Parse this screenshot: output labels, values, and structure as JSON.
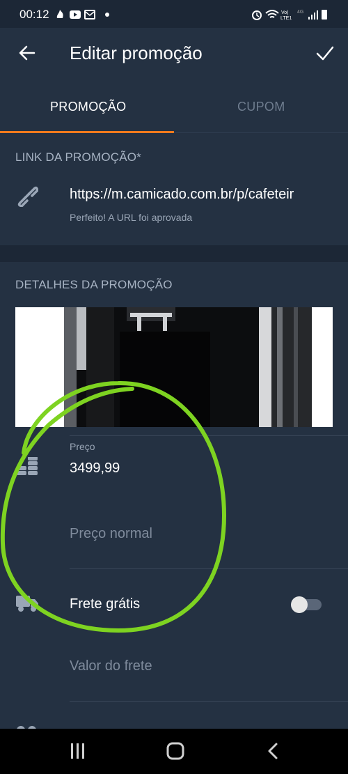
{
  "status_bar": {
    "time": "00:12",
    "icons": [
      "fire-icon",
      "youtube-icon",
      "gmail-icon",
      "dot-icon",
      "alarm-icon",
      "wifi-icon",
      "volte-icon",
      "signal-icon",
      "battery-icon"
    ],
    "network_label_top": "Vo)",
    "network_label_bottom": "LTE1",
    "network_4g": "4G"
  },
  "app_bar": {
    "title": "Editar promoção",
    "back_icon": "arrow-left-icon",
    "confirm_icon": "check-icon"
  },
  "tabs": [
    {
      "label": "PROMOÇÃO",
      "active": true
    },
    {
      "label": "CUPOM",
      "active": false
    }
  ],
  "link_section": {
    "header": "LINK DA PROMOÇÃO*",
    "icon": "link-icon",
    "url": "https://m.camicado.com.br/p/cafeteir",
    "helper": "Perfeito! A URL foi aprovada"
  },
  "details_section": {
    "header": "DETALHES DA PROMOÇÃO",
    "price_label": "Preço",
    "price_value": "3499,99",
    "price_icon": "coins-icon",
    "normal_price_placeholder": "Preço normal",
    "free_shipping_label": "Frete grátis",
    "free_shipping_icon": "truck-icon",
    "free_shipping_on": false,
    "shipping_value_placeholder": "Valor do frete"
  },
  "colors": {
    "background": "#243142",
    "accent": "#f07a1d",
    "annotation": "#7ed321"
  },
  "nav_bar": {
    "icons": [
      "recent-apps-icon",
      "home-icon",
      "back-icon"
    ]
  }
}
